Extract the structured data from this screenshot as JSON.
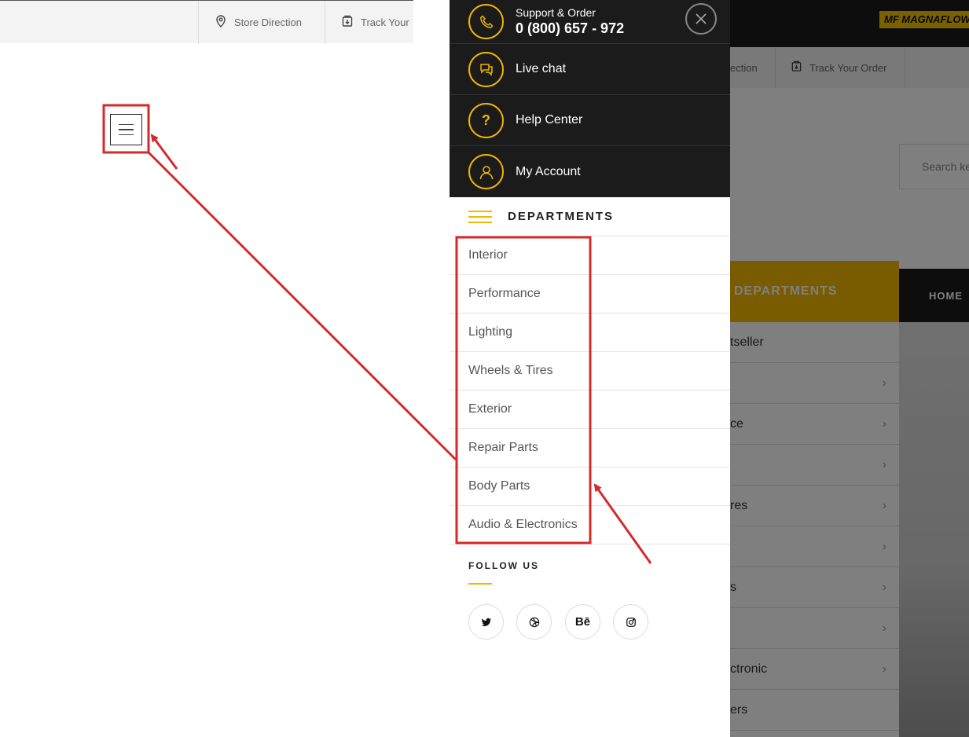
{
  "colors": {
    "accent": "#f2b600",
    "annotation": "#d42a2a",
    "drawer_dark": "#1b1b1b"
  },
  "left_topbar": {
    "store_direction": {
      "icon": "map-pin-icon",
      "label": "Store Direction"
    },
    "track_order": {
      "icon": "package-icon",
      "label": "Track Your"
    }
  },
  "mobile_menu_button": {
    "icon": "hamburger-menu-icon"
  },
  "drawer": {
    "support": {
      "icon": "phone-icon",
      "subtitle": "Support & Order",
      "phone": "0 (800) 657 - 972"
    },
    "close": {
      "icon": "close-icon"
    },
    "links": [
      {
        "icon": "chat-icon",
        "label": "Live chat"
      },
      {
        "icon": "help-icon",
        "label": "Help Center"
      },
      {
        "icon": "user-icon",
        "label": "My Account"
      }
    ],
    "departments_title": "DEPARTMENTS",
    "departments": [
      "Interior",
      "Performance",
      "Lighting",
      "Wheels & Tires",
      "Exterior",
      "Repair Parts",
      "Body Parts",
      "Audio & Electronics"
    ],
    "follow_title": "FOLLOW US",
    "social": [
      {
        "icon": "twitter-icon"
      },
      {
        "icon": "dribbble-icon"
      },
      {
        "icon": "behance-icon",
        "label": "Bē"
      },
      {
        "icon": "instagram-icon"
      }
    ]
  },
  "background_page": {
    "logo": "MF MAGNAFLOW",
    "topbar": {
      "store_direction_partial": "ection",
      "track_order": "Track Your Order"
    },
    "search_placeholder_partial": "Search ke",
    "departments_label": "DEPARTMENTS",
    "nav_home": "HOME",
    "list_partial": [
      "tseller",
      "",
      "ce",
      "",
      "res",
      "",
      "s",
      "",
      "ctronic",
      "ers"
    ]
  }
}
